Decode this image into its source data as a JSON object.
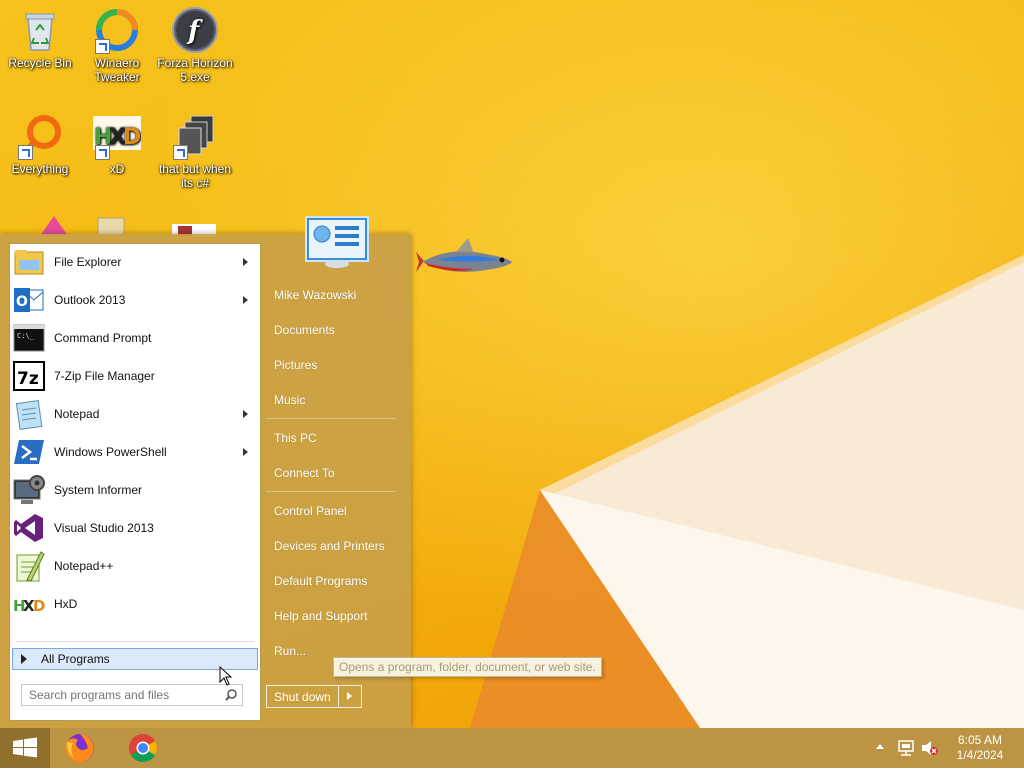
{
  "desktop": {
    "icons": [
      {
        "label": "Recycle Bin",
        "icon": "recycle-bin-icon",
        "shortcut": false
      },
      {
        "label": "Winaero Tweaker",
        "icon": "winaero-icon",
        "shortcut": true
      },
      {
        "label": "Forza Horizon 5.exe",
        "icon": "flash-icon",
        "shortcut": false
      },
      {
        "label": "Everything",
        "icon": "everything-icon",
        "shortcut": true
      },
      {
        "label": "xD",
        "icon": "hxd-icon",
        "shortcut": true
      },
      {
        "label": "that but when its c#",
        "icon": "stacked-windows-icon",
        "shortcut": true
      }
    ]
  },
  "start_menu": {
    "programs": [
      {
        "label": "File Explorer",
        "icon": "file-explorer-icon",
        "submenu": true
      },
      {
        "label": "Outlook 2013",
        "icon": "outlook-icon",
        "submenu": true
      },
      {
        "label": "Command Prompt",
        "icon": "command-prompt-icon",
        "submenu": false
      },
      {
        "label": "7-Zip File Manager",
        "icon": "7zip-icon",
        "submenu": false
      },
      {
        "label": "Notepad",
        "icon": "notepad-icon",
        "submenu": true
      },
      {
        "label": "Windows PowerShell",
        "icon": "powershell-icon",
        "submenu": true
      },
      {
        "label": "System Informer",
        "icon": "system-informer-icon",
        "submenu": false
      },
      {
        "label": "Visual Studio 2013",
        "icon": "visual-studio-icon",
        "submenu": false
      },
      {
        "label": "Notepad++",
        "icon": "notepad-plus-plus-icon",
        "submenu": false
      },
      {
        "label": "HxD",
        "icon": "hxd-icon",
        "submenu": false
      }
    ],
    "all_programs": "All Programs",
    "search_placeholder": "Search programs and files",
    "right_links": {
      "user": "Mike Wazowski",
      "documents": "Documents",
      "pictures": "Pictures",
      "music": "Music",
      "this_pc": "This PC",
      "connect_to": "Connect To",
      "control_panel": "Control Panel",
      "devices_printers": "Devices and Printers",
      "default_programs": "Default Programs",
      "help_support": "Help and Support",
      "run": "Run..."
    },
    "shutdown_label": "Shut down",
    "tooltip": "Opens a program, folder, document, or web site."
  },
  "taskbar": {
    "apps": [
      {
        "name": "Firefox",
        "icon": "firefox-icon"
      },
      {
        "name": "Chrome",
        "icon": "chrome-icon"
      }
    ],
    "clock": {
      "time": "6:05 AM",
      "date": "1/4/2024"
    }
  },
  "colors": {
    "wallpaper": "#f5b914",
    "menu": "#c8a046",
    "taskbar": "#b8903c",
    "selection": "#dce9fb"
  }
}
